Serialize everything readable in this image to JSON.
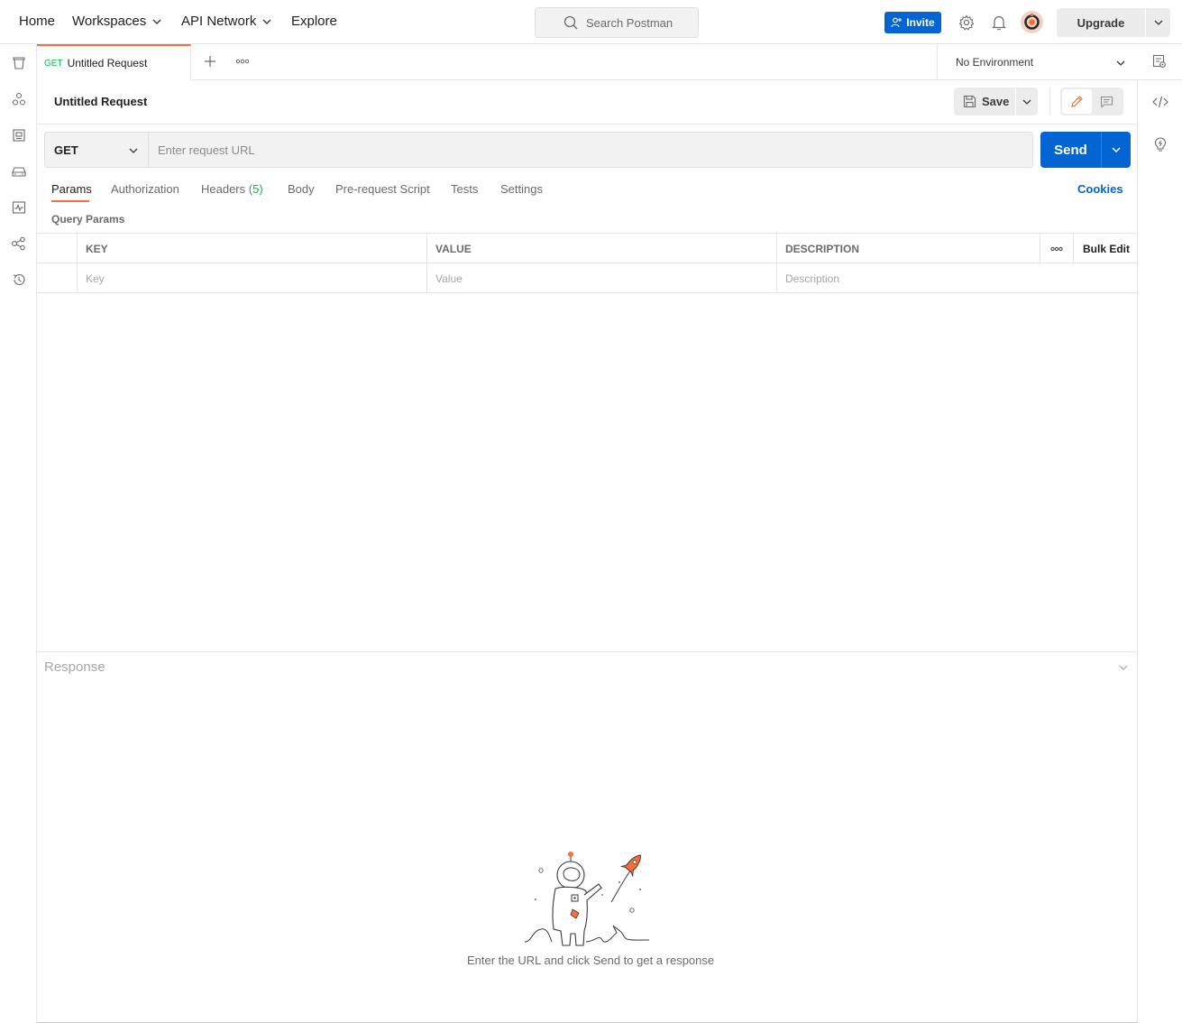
{
  "header": {
    "nav": [
      {
        "label": "Home"
      },
      {
        "label": "Workspaces"
      },
      {
        "label": "API Network"
      },
      {
        "label": "Explore"
      }
    ],
    "search_placeholder": "Search Postman",
    "invite_label": "Invite",
    "upgrade_label": "Upgrade"
  },
  "tabs": {
    "active": {
      "method": "GET",
      "name": "Untitled Request"
    }
  },
  "environment": {
    "selected": "No Environment"
  },
  "request": {
    "title": "Untitled Request",
    "save_label": "Save",
    "method": "GET",
    "url_value": "",
    "url_placeholder": "Enter request URL",
    "send_label": "Send",
    "subtabs": [
      {
        "label": "Params"
      },
      {
        "label": "Authorization"
      },
      {
        "label": "Headers",
        "count": "(5)"
      },
      {
        "label": "Body"
      },
      {
        "label": "Pre-request Script"
      },
      {
        "label": "Tests"
      },
      {
        "label": "Settings"
      }
    ],
    "cookies_label": "Cookies",
    "query_params_title": "Query Params",
    "params_table": {
      "columns": [
        "KEY",
        "VALUE",
        "DESCRIPTION"
      ],
      "bulk_edit_label": "Bulk Edit",
      "placeholders": {
        "key": "Key",
        "value": "Value",
        "description": "Description"
      }
    }
  },
  "response": {
    "label": "Response",
    "empty_message": "Enter the URL and click Send to get a response"
  },
  "colors": {
    "accent_orange": "#ff6c37",
    "primary_blue": "#0265d2",
    "method_green": "#0cbb52"
  }
}
